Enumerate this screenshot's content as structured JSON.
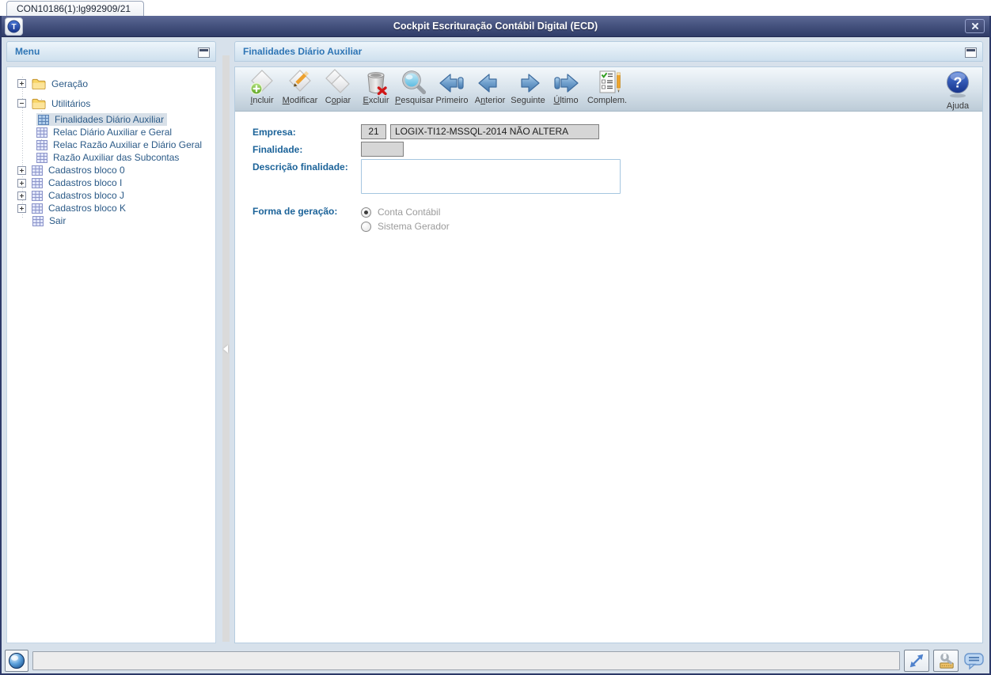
{
  "window": {
    "tab_label": "CON10186(1):lg992909/21",
    "title": "Cockpit Escrituração Contábil Digital (ECD)"
  },
  "colors": {
    "titlebar": "#39466f",
    "panel_header_text": "#2e75b5",
    "tree_text": "#2b5a87",
    "tree_selection_bg": "#d8e0e8",
    "form_label": "#1c6399",
    "readonly_field_bg": "#d6d6d6",
    "accent_arrow_blue": "#4a7cb0",
    "help_blue": "#2a4fb0"
  },
  "sidebar": {
    "header": "Menu",
    "tree": [
      {
        "label": "Geração",
        "icon": "folder-icon",
        "expander": "+",
        "level": 0,
        "selected": false
      },
      {
        "label": "Utilitários",
        "icon": "folder-icon",
        "expander": "-",
        "level": 0,
        "selected": false
      },
      {
        "label": "Finalidades Diário Auxiliar",
        "icon": "grid-icon",
        "expander": null,
        "level": 1,
        "selected": true
      },
      {
        "label": "Relac Diário Auxiliar e Geral",
        "icon": "grid-icon",
        "expander": null,
        "level": 1,
        "selected": false
      },
      {
        "label": "Relac Razão Auxiliar e Diário Geral",
        "icon": "grid-icon",
        "expander": null,
        "level": 1,
        "selected": false
      },
      {
        "label": "Razão Auxiliar das Subcontas",
        "icon": "grid-icon",
        "expander": null,
        "level": 1,
        "selected": false
      },
      {
        "label": "Cadastros bloco 0",
        "icon": "grid-icon",
        "expander": "+",
        "level": 0,
        "selected": false
      },
      {
        "label": "Cadastros bloco I",
        "icon": "grid-icon",
        "expander": "+",
        "level": 0,
        "selected": false
      },
      {
        "label": "Cadastros bloco J",
        "icon": "grid-icon",
        "expander": "+",
        "level": 0,
        "selected": false
      },
      {
        "label": "Cadastros bloco K",
        "icon": "grid-icon",
        "expander": "+",
        "level": 0,
        "selected": false
      },
      {
        "label": "Sair",
        "icon": "grid-icon",
        "expander": null,
        "level": 0,
        "selected": false
      }
    ]
  },
  "main": {
    "header": "Finalidades Diário Auxiliar",
    "toolbar": [
      {
        "icon": "add-icon",
        "pre": "",
        "key": "I",
        "post": "ncluir"
      },
      {
        "icon": "edit-icon",
        "pre": "",
        "key": "M",
        "post": "odificar"
      },
      {
        "icon": "copy-icon",
        "pre": "C",
        "key": "o",
        "post": "piar"
      },
      {
        "icon": "delete-icon",
        "pre": "",
        "key": "E",
        "post": "xcluir"
      },
      {
        "icon": "search-icon",
        "pre": "",
        "key": "P",
        "post": "esquisar"
      },
      {
        "icon": "first-icon",
        "pre": "Primeiro",
        "key": "",
        "post": ""
      },
      {
        "icon": "previous-icon",
        "pre": "A",
        "key": "n",
        "post": "terior"
      },
      {
        "icon": "next-icon",
        "pre": "Se",
        "key": "g",
        "post": "uinte"
      },
      {
        "icon": "last-icon",
        "pre": "",
        "key": "Ú",
        "post": "ltimo"
      },
      {
        "icon": "complement-icon",
        "pre": "Complem.",
        "key": "",
        "post": ""
      }
    ],
    "help": {
      "icon": "help-icon",
      "label": "Ajuda"
    },
    "form": {
      "empresa": {
        "label": "Empresa:",
        "code": "21",
        "name": "LOGIX-TI12-MSSQL-2014 NÃO ALTERA"
      },
      "finalidade": {
        "label": "Finalidade:",
        "value": ""
      },
      "descricao": {
        "label": "Descrição finalidade:",
        "value": ""
      },
      "forma": {
        "label": "Forma de geração:",
        "options": [
          {
            "label": "Conta Contábil",
            "selected": true
          },
          {
            "label": "Sistema Gerador",
            "selected": false
          }
        ]
      }
    }
  },
  "statusbar": {
    "message": ""
  }
}
